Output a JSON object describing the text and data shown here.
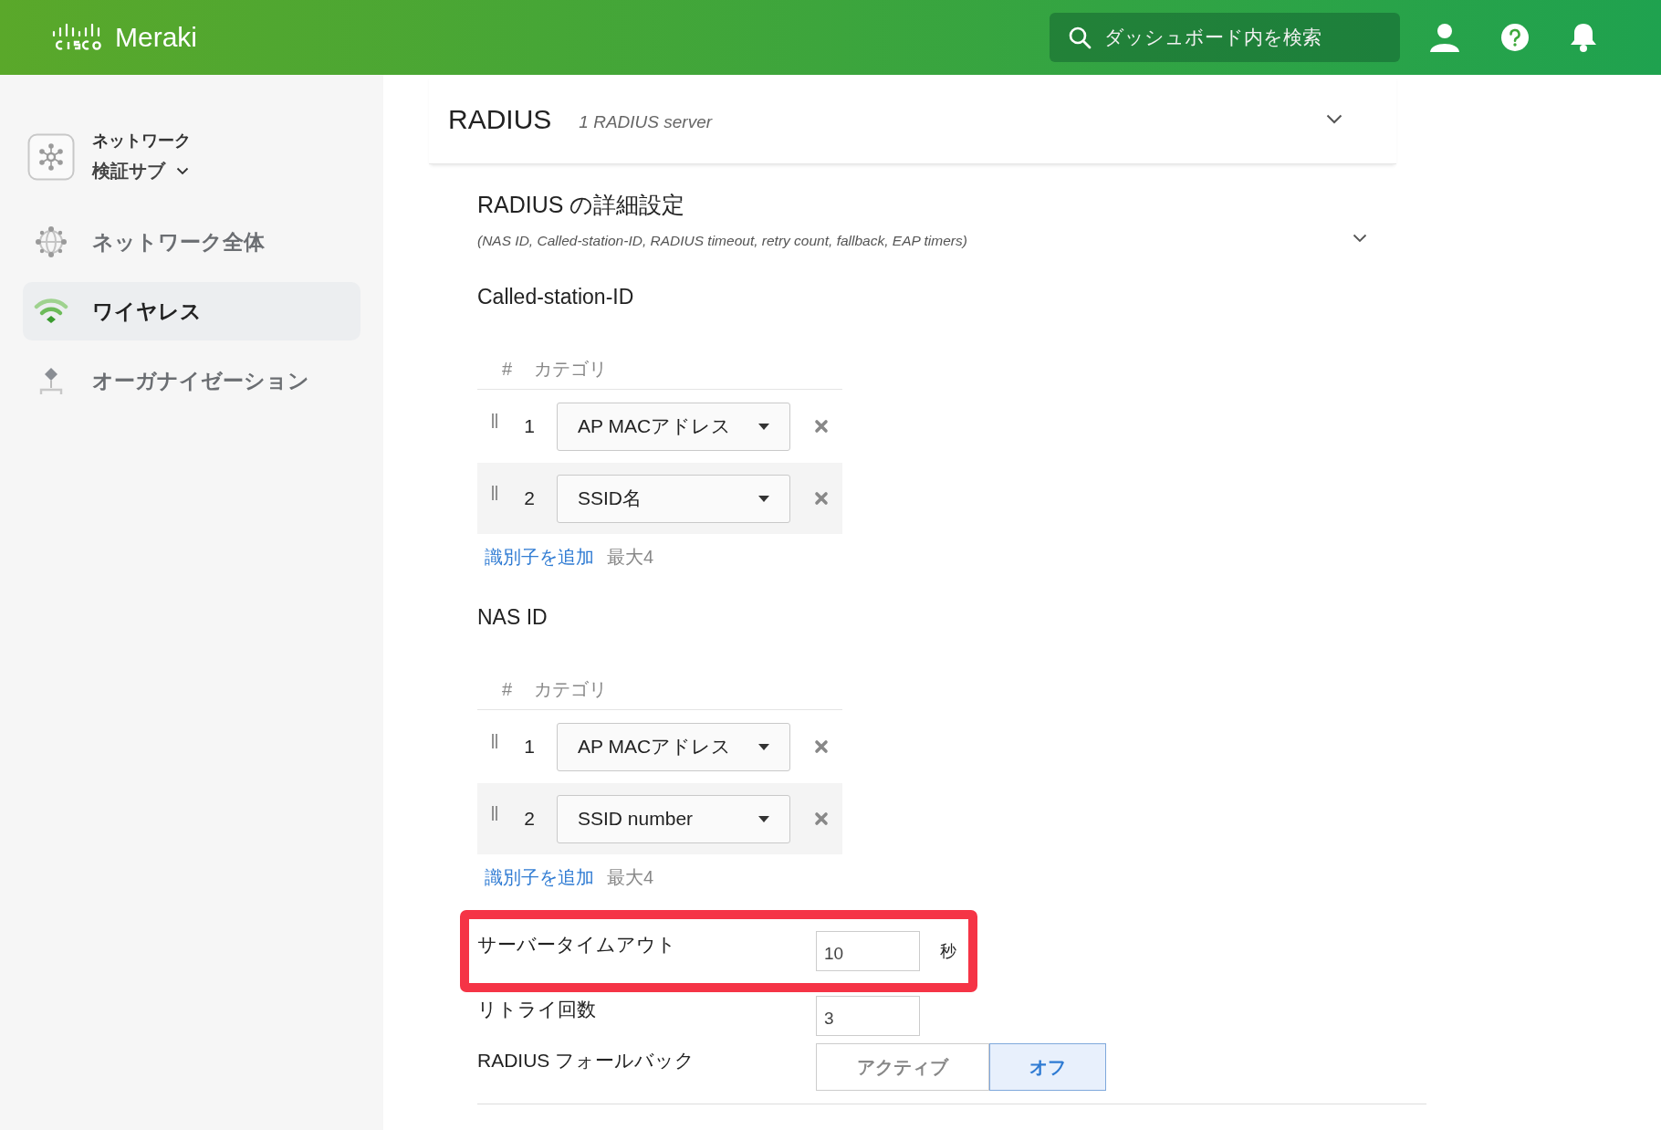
{
  "topbar": {
    "brand": "Meraki",
    "search": {
      "placeholder": "ダッシュボード内を検索"
    }
  },
  "sidebar": {
    "network": {
      "line1": "ネットワーク",
      "line2": "検証サブ"
    },
    "items": [
      {
        "label": "ネットワーク全体",
        "kind": "network-wide",
        "selected": false
      },
      {
        "label": "ワイヤレス",
        "kind": "wireless",
        "selected": true
      },
      {
        "label": "オーガナイゼーション",
        "kind": "organization",
        "selected": false
      }
    ]
  },
  "panel": {
    "title": "RADIUS",
    "subtitle": "1 RADIUS server"
  },
  "advanced": {
    "title": "RADIUS の詳細設定",
    "subtitle": "(NAS ID, Called-station-ID, RADIUS timeout, retry count, fallback, EAP timers)"
  },
  "identifier_tables": [
    {
      "title": "Called-station-ID",
      "columns": [
        "#",
        "カテゴリ"
      ],
      "rows": [
        {
          "number": "1",
          "value": "AP MACアドレス"
        },
        {
          "number": "2",
          "value": "SSID名"
        }
      ],
      "add_link": "識別子を追加",
      "limit": "最大4"
    },
    {
      "title": "NAS ID",
      "columns": [
        "#",
        "カテゴリ"
      ],
      "rows": [
        {
          "number": "1",
          "value": "AP MACアドレス"
        },
        {
          "number": "2",
          "value": "SSID number"
        }
      ],
      "add_link": "識別子を追加",
      "limit": "最大4"
    }
  ],
  "settings": [
    {
      "kind": "number",
      "label": "サーバータイムアウト",
      "value": "10",
      "unit": "秒",
      "highlighted": true
    },
    {
      "kind": "number",
      "label": "リトライ回数",
      "value": "3",
      "highlighted": false
    },
    {
      "kind": "toggle",
      "label": "RADIUS フォールバック",
      "options": [
        {
          "label": "アクティブ",
          "selected": false
        },
        {
          "label": "オフ",
          "selected": true
        }
      ],
      "highlighted": false
    }
  ]
}
